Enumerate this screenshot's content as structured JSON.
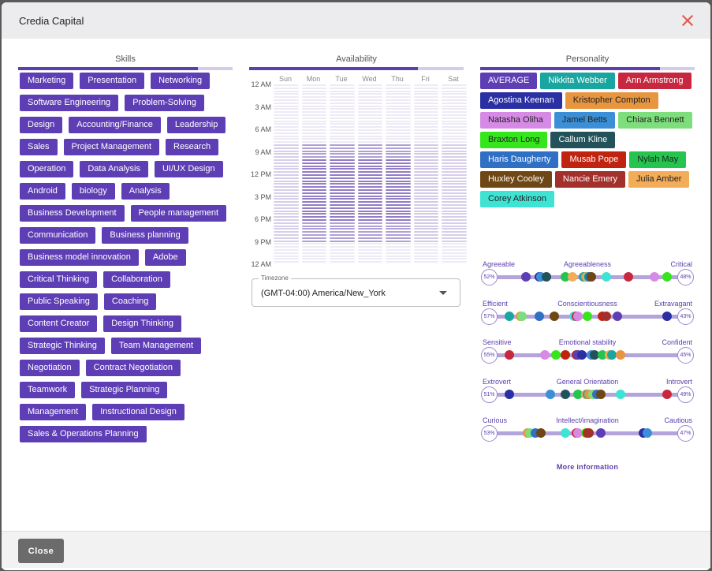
{
  "header": {
    "title": "Credia Capital"
  },
  "columns": {
    "skills": "Skills",
    "availability": "Availability",
    "personality": "Personality"
  },
  "skills": [
    "Marketing",
    "Presentation",
    "Networking",
    "Software Engineering",
    "Problem-Solving",
    "Design",
    "Accounting/Finance",
    "Leadership",
    "Sales",
    "Project Management",
    "Research",
    "Operation",
    "Data Analysis",
    "UI/UX Design",
    "Android",
    "biology",
    "Analysis",
    "Business Development",
    "People management",
    "Communication",
    "Business planning",
    "Business model innovation",
    "Adobe",
    "Critical Thinking",
    "Collaboration",
    "Public Speaking",
    "Coaching",
    "Content Creator",
    "Design Thinking",
    "Strategic Thinking",
    "Team Management",
    "Negotiation",
    "Contract Negotiation",
    "Teamwork",
    "Strategic Planning",
    "Management",
    "Instructional Design",
    "Sales & Operations Planning"
  ],
  "availability": {
    "days": [
      "Sun",
      "Mon",
      "Tue",
      "Wed",
      "Thu",
      "Fri",
      "Sat"
    ],
    "times": [
      "12 AM",
      "3 AM",
      "6 AM",
      "9 AM",
      "12 PM",
      "3 PM",
      "6 PM",
      "9 PM",
      "12 AM"
    ],
    "timezone_label": "Timezone",
    "timezone_value": "(GMT-04:00) America/New_York"
  },
  "people": [
    {
      "name": "AVERAGE",
      "color": "#5e3eb5"
    },
    {
      "name": "Nikkita Webber",
      "color": "#1aa6a0"
    },
    {
      "name": "Ann Armstrong",
      "color": "#c8283f"
    },
    {
      "name": "Agostina Keenan",
      "color": "#2a2fa3"
    },
    {
      "name": "Kristopher Compton",
      "color": "#e8953f",
      "dark": true
    },
    {
      "name": "Natasha Oliha",
      "color": "#d68ae6",
      "dark": true
    },
    {
      "name": "Jamel Betts",
      "color": "#3b8fd6",
      "dark": true
    },
    {
      "name": "Chiara Bennett",
      "color": "#7dde7b",
      "dark": true
    },
    {
      "name": "Braxton Long",
      "color": "#35e61d",
      "dark": true
    },
    {
      "name": "Callum Kline",
      "color": "#23525a"
    },
    {
      "name": "Haris Daugherty",
      "color": "#2f6fc4"
    },
    {
      "name": "Musab Pope",
      "color": "#c02410"
    },
    {
      "name": "Nylah May",
      "color": "#25c44e",
      "dark": true
    },
    {
      "name": "Huxley Cooley",
      "color": "#6f4714"
    },
    {
      "name": "Nancie Emery",
      "color": "#a4302c"
    },
    {
      "name": "Julia Amber",
      "color": "#f3ad59",
      "dark": true
    },
    {
      "name": "Corey Atkinson",
      "color": "#3ee3d3",
      "dark": true
    }
  ],
  "traits": [
    {
      "left": "Agreeable",
      "name": "Agreeableness",
      "right": "Critical",
      "left_pct": "52%",
      "right_pct": "48%"
    },
    {
      "left": "Efficient",
      "name": "Conscientiousness",
      "right": "Extravagant",
      "left_pct": "57%",
      "right_pct": "43%"
    },
    {
      "left": "Sensitive",
      "name": "Emotional stability",
      "right": "Confident",
      "left_pct": "55%",
      "right_pct": "45%"
    },
    {
      "left": "Extrovert",
      "name": "General Orientation",
      "right": "Introvert",
      "left_pct": "51%",
      "right_pct": "49%"
    },
    {
      "left": "Curious",
      "name": "Intellect/imagination",
      "right": "Cautious",
      "left_pct": "53%",
      "right_pct": "47%"
    }
  ],
  "more_info": "More information",
  "footer": {
    "close": "Close"
  }
}
